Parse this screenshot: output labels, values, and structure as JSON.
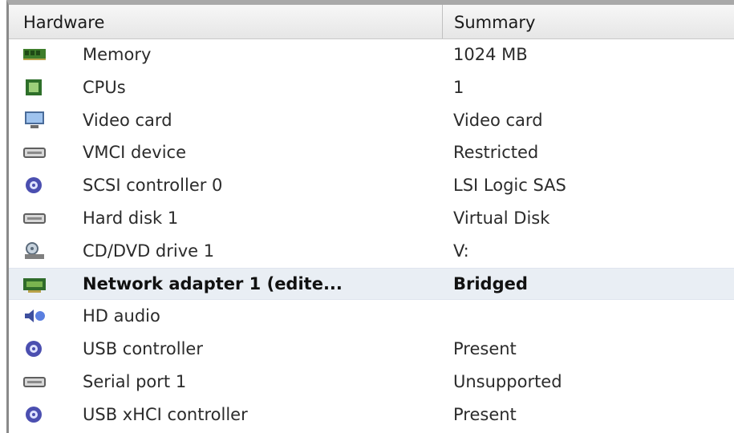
{
  "header": {
    "hardware": "Hardware",
    "summary": "Summary"
  },
  "rows": [
    {
      "icon": "memory-icon",
      "name": "Memory",
      "summary": "1024 MB"
    },
    {
      "icon": "cpu-icon",
      "name": "CPUs",
      "summary": "1"
    },
    {
      "icon": "monitor-icon",
      "name": "Video card",
      "summary": "Video card"
    },
    {
      "icon": "device-icon",
      "name": "VMCI device",
      "summary": "Restricted"
    },
    {
      "icon": "controller-icon",
      "name": "SCSI controller 0",
      "summary": "LSI Logic SAS"
    },
    {
      "icon": "device-icon",
      "name": "Hard disk 1",
      "summary": "Virtual Disk"
    },
    {
      "icon": "cd-drive-icon",
      "name": "CD/DVD drive 1",
      "summary": "V:"
    },
    {
      "icon": "network-icon",
      "name": "Network adapter 1 (edite...",
      "summary": "Bridged",
      "selected": true
    },
    {
      "icon": "speaker-icon",
      "name": "HD audio",
      "summary": ""
    },
    {
      "icon": "controller-icon",
      "name": "USB controller",
      "summary": "Present"
    },
    {
      "icon": "device-icon",
      "name": "Serial port 1",
      "summary": "Unsupported"
    },
    {
      "icon": "controller-icon",
      "name": "USB xHCI controller",
      "summary": "Present"
    }
  ]
}
